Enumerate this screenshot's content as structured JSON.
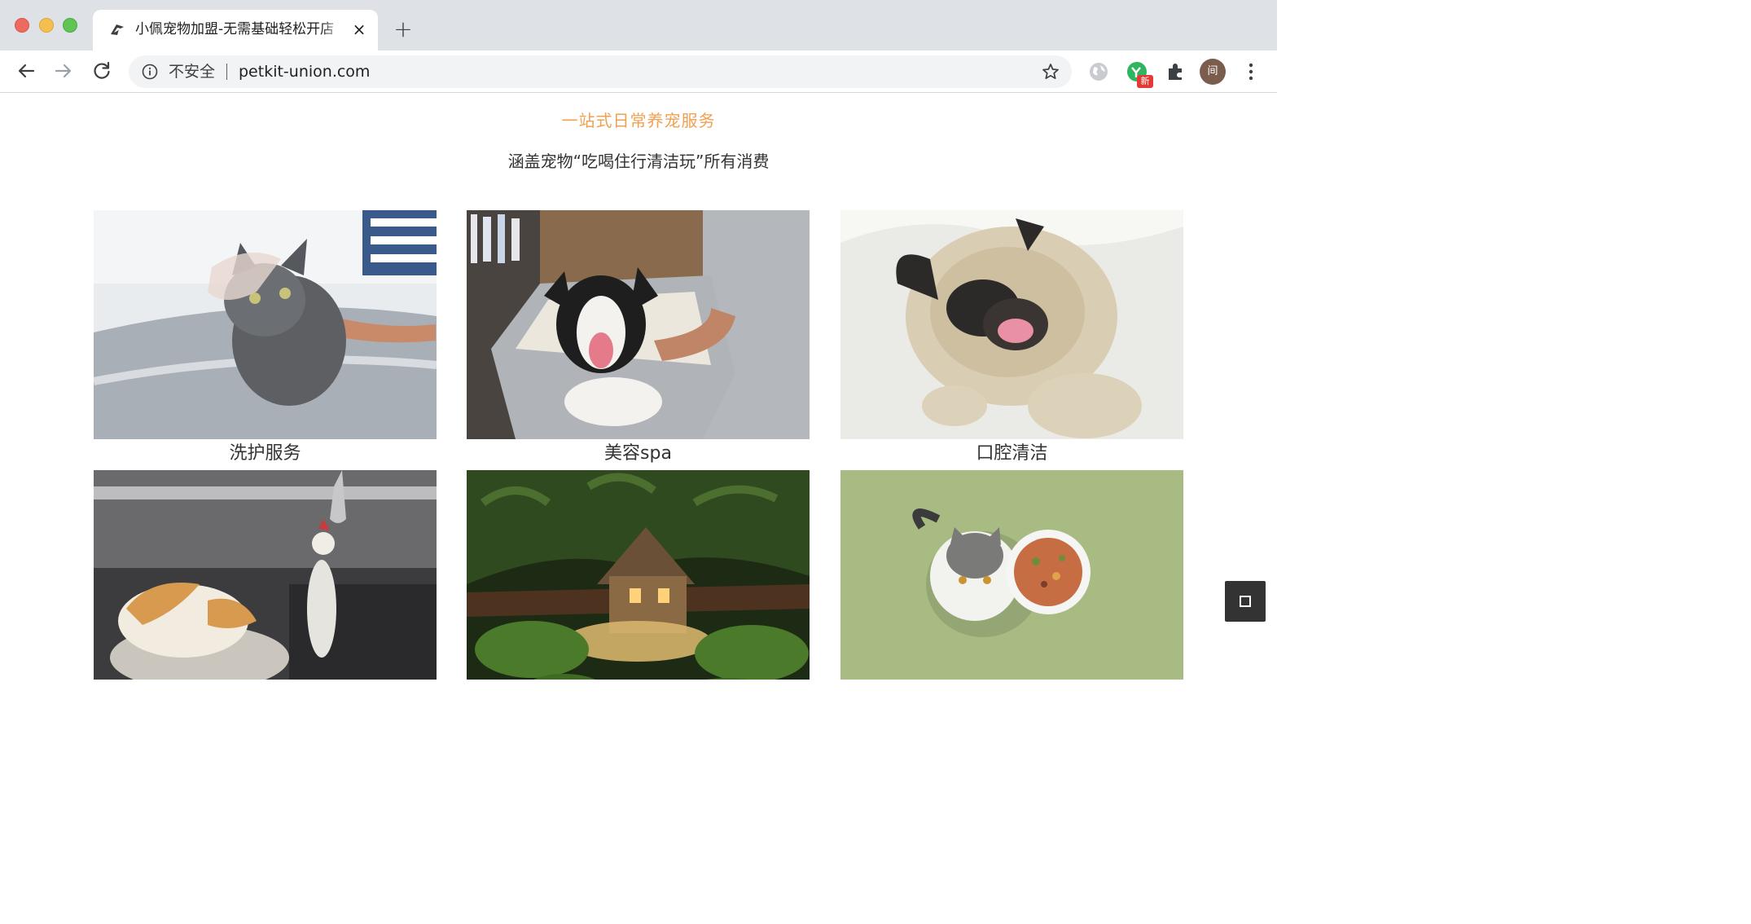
{
  "browser": {
    "tab_title": "小佩宠物加盟-无需基础轻松开店",
    "tab_close_icon": "×",
    "new_tab_icon": "+",
    "security_label": "不安全",
    "url": "petkit-union.com",
    "extension_badge": "新",
    "profile_initial": "间"
  },
  "page": {
    "headline": "一站式日常养宠服务",
    "subheadline": "涵盖宠物“吃喝住行清洁玩”所有消费",
    "services": [
      {
        "label": "洗护服务",
        "image": "cat-bath-photo"
      },
      {
        "label": "美容spa",
        "image": "dog-grooming-photo"
      },
      {
        "label": "口腔清洁",
        "image": "pug-smiling-photo"
      },
      {
        "label": "",
        "image": "cat-sleeping-cage-photo"
      },
      {
        "label": "",
        "image": "miniature-house-garden-photo"
      },
      {
        "label": "",
        "image": "cat-food-bowl-photo"
      }
    ]
  },
  "colors": {
    "accent": "#f0a050",
    "text": "#333333",
    "chrome_bg": "#dee1e6"
  }
}
